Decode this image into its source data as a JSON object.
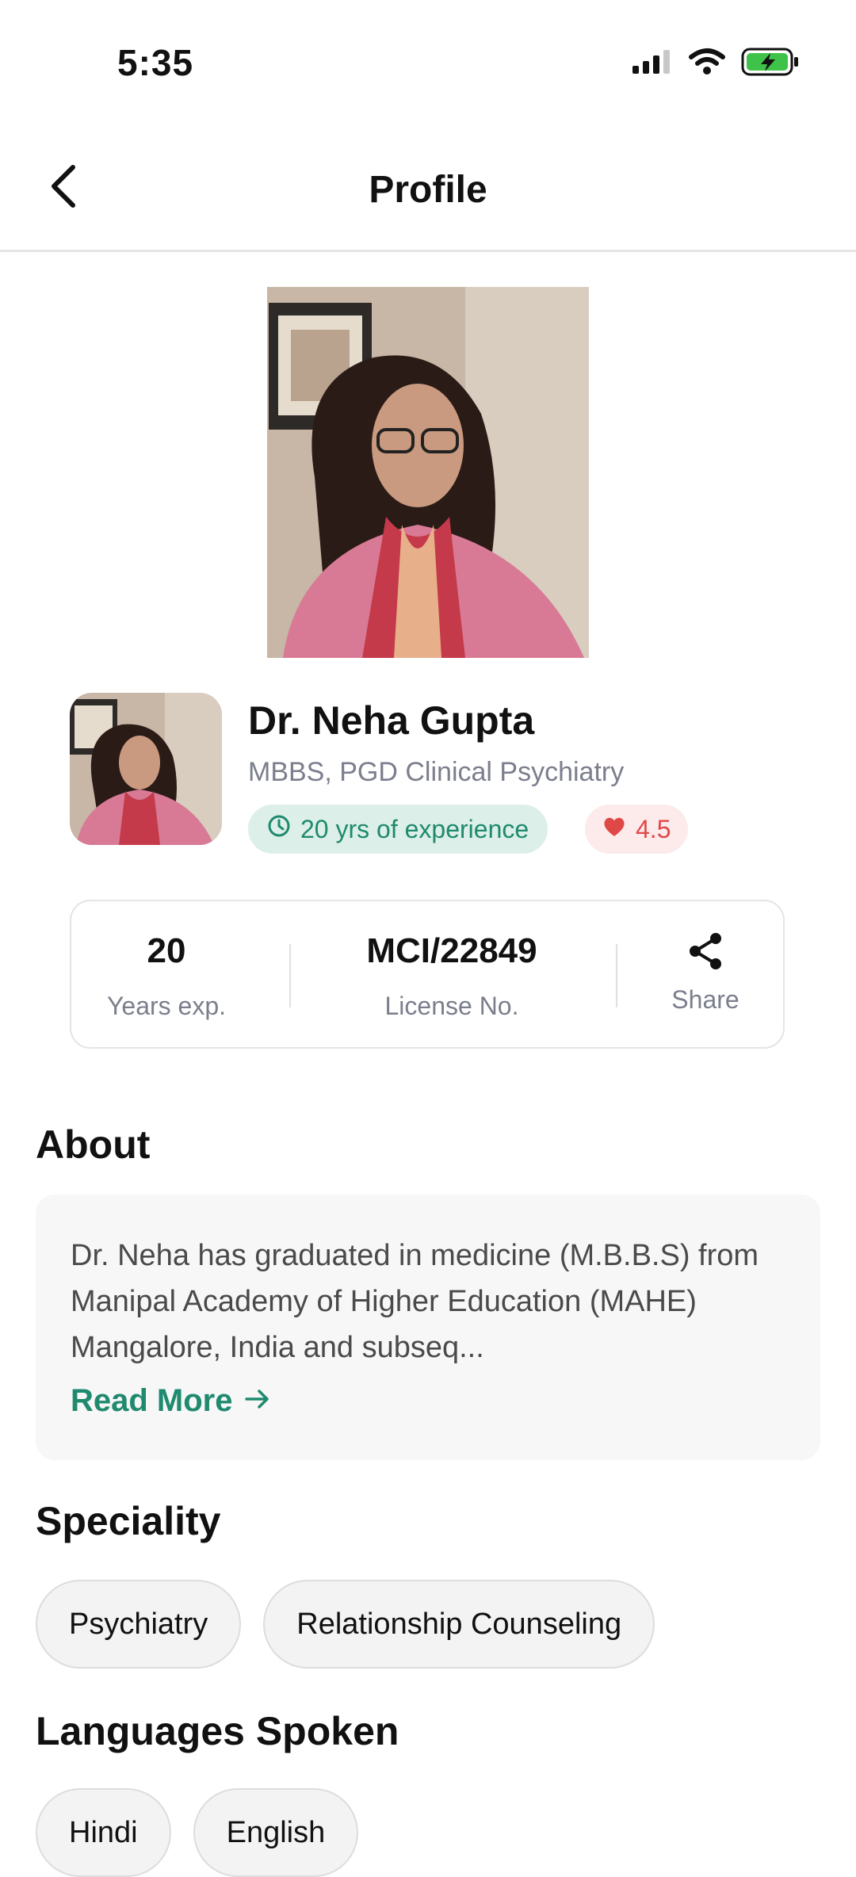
{
  "status_bar": {
    "time": "5:35"
  },
  "header": {
    "title": "Profile"
  },
  "doctor": {
    "name": "Dr. Neha Gupta",
    "qualification": "MBBS, PGD Clinical Psychiatry",
    "experience_badge": "20 yrs of experience",
    "rating": "4.5"
  },
  "stats": {
    "years_value": "20",
    "years_label": "Years exp.",
    "license_value": "MCI/22849",
    "license_label": "License No.",
    "share_label": "Share"
  },
  "about": {
    "title": "About",
    "text": "Dr. Neha has graduated in medicine (M.B.B.S) from Manipal Academy of Higher Education (MAHE) Mangalore, India and subseq...",
    "read_more": "Read More"
  },
  "speciality": {
    "title": "Speciality",
    "items": [
      "Psychiatry",
      "Relationship Counseling"
    ]
  },
  "languages": {
    "title": "Languages Spoken",
    "items": [
      "Hindi",
      "English"
    ]
  },
  "colors": {
    "accent": "#1f8a6e",
    "badge_bg": "#dcefe8",
    "rating": "#e04848"
  }
}
